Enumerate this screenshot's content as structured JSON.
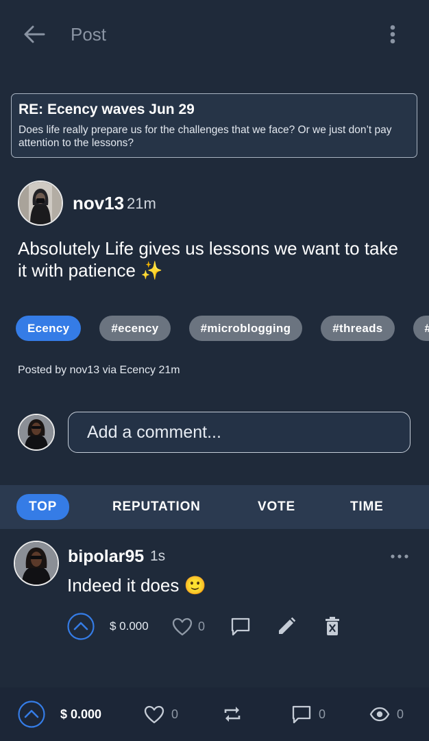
{
  "header": {
    "title": "Post"
  },
  "parent_post": {
    "title": "RE: Ecency waves Jun 29",
    "body": "Does life really prepare us for the challenges that we face? Or we just don’t pay attention to the lessons?"
  },
  "post": {
    "author": "nov13",
    "time": "21m",
    "body": "Absolutely Life gives us lessons we want to take it with patience ✨",
    "tags": [
      "Ecency",
      "#ecency",
      "#microblogging",
      "#threads",
      "#"
    ],
    "posted_by": "Posted by nov13 via Ecency 21m"
  },
  "comment_box": {
    "placeholder": "Add a comment..."
  },
  "sort_tabs": [
    "TOP",
    "REPUTATION",
    "VOTE",
    "TIME"
  ],
  "active_sort": "TOP",
  "comments": [
    {
      "author": "bipolar95",
      "time": "1s",
      "body": "Indeed it does 🙂",
      "payout": "$ 0.000",
      "likes": "0"
    }
  ],
  "bottom_bar": {
    "payout": "$ 0.000",
    "likes": "0",
    "comments": "0",
    "views": "0"
  },
  "colors": {
    "background": "#1f2a3a",
    "accent": "#357ce6",
    "tag_gray": "#6b7480"
  }
}
